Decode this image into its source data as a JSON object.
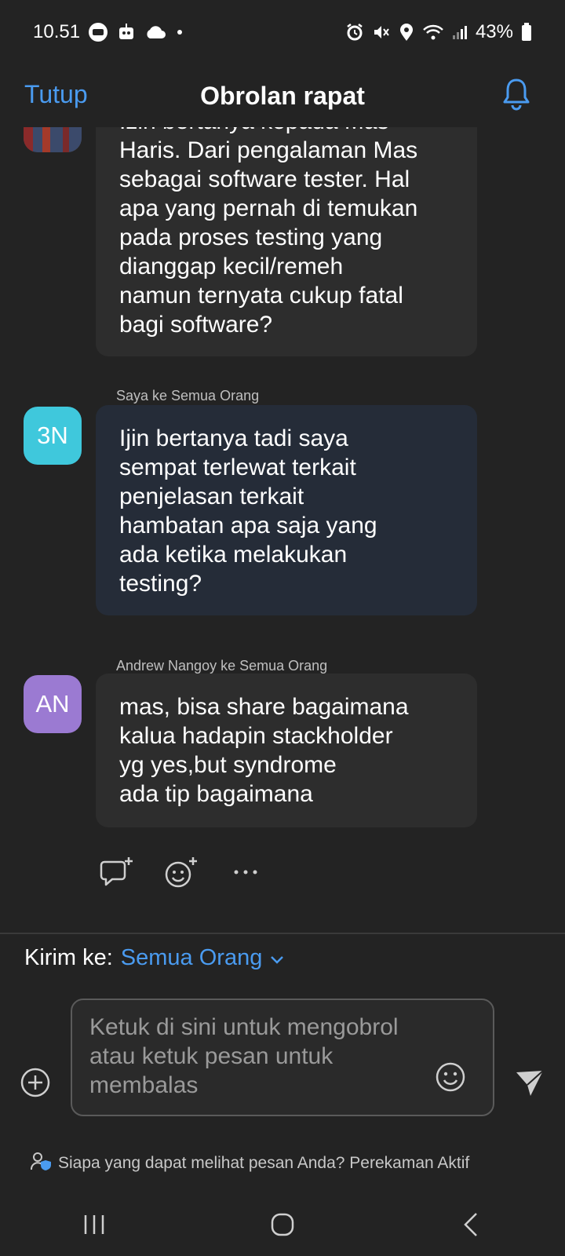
{
  "status_bar": {
    "time": "10.51",
    "battery": "43%"
  },
  "header": {
    "close_label": "Tutup",
    "title": "Obrolan rapat"
  },
  "messages": [
    {
      "avatar": "",
      "sender": "",
      "text": "Izin bertanya kepada Mas\nHaris. Dari pengalaman Mas\nsebagai software tester. Hal\napa yang pernah di temukan\npada proses testing yang\ndianggap kecil/remeh\nnamun ternyata cukup fatal\nbagi software?"
    },
    {
      "avatar": "3N",
      "avatar_color": "#3fc8dc",
      "sender": "Saya ke Semua Orang",
      "text": "Ijin bertanya tadi saya\nsempat terlewat terkait\npenjelasan terkait\nhambatan apa saja yang\nada ketika melakukan\ntesting?"
    },
    {
      "avatar": "AN",
      "avatar_color": "#9b7ad2",
      "sender": "Andrew Nangoy ke Semua Orang",
      "text": "mas, bisa share bagaimana\nkalua hadapin stackholder\nyg yes,but syndrome\nada tip bagaimana"
    }
  ],
  "message_actions": [
    "reply-icon",
    "add-reaction-icon",
    "more-icon"
  ],
  "compose": {
    "send_to_label": "Kirim ke:",
    "send_to_target": "Semua Orang",
    "placeholder": "Ketuk di sini untuk mengobrol atau ketuk pesan untuk membalas"
  },
  "privacy_text": "Siapa yang dapat melihat pesan Anda? Perekaman Aktif",
  "colors": {
    "background": "#232323",
    "accent": "#4a9bf0",
    "bubble": "#2d2d2d",
    "bubble_self": "#252c38"
  }
}
